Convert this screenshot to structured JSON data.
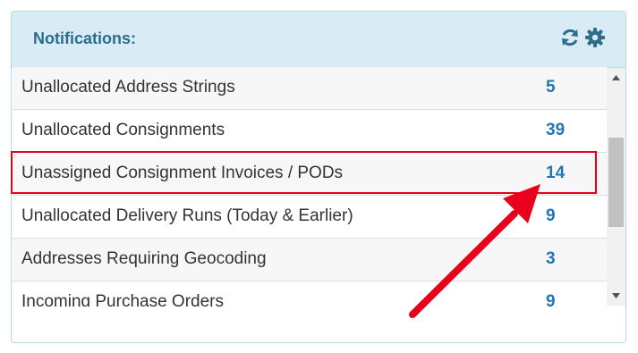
{
  "panel": {
    "title": "Notifications:",
    "header_icons": [
      "refresh-icon",
      "gear-icon"
    ]
  },
  "notifications": [
    {
      "label": "Unallocated Address Strings",
      "count": "5"
    },
    {
      "label": "Unallocated Consignments",
      "count": "39"
    },
    {
      "label": "Unassigned Consignment Invoices / PODs",
      "count": "14"
    },
    {
      "label": "Unallocated Delivery Runs (Today & Earlier)",
      "count": "9"
    },
    {
      "label": "Addresses Requiring Geocoding",
      "count": "3"
    },
    {
      "label": "Incoming Purchase Orders",
      "count": "9"
    }
  ],
  "colors": {
    "header_bg": "#d9ecf5",
    "title": "#2e6c8c",
    "count": "#1f78b4",
    "highlight": "#e8001c"
  }
}
